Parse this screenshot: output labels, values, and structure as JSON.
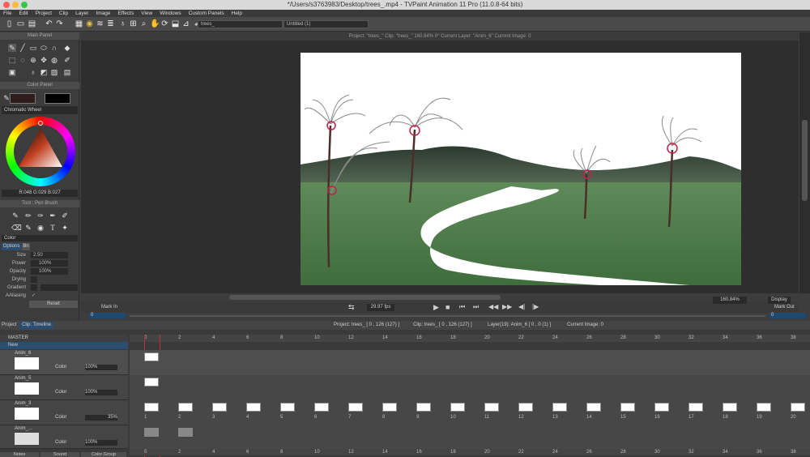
{
  "window": {
    "title": "*/Users/s3763983/Desktop/trees_.mp4 - TVPaint Animation 11 Pro (11.0.8-64 bits)"
  },
  "menu": [
    "File",
    "Edit",
    "Project",
    "Clip",
    "Layer",
    "Image",
    "Effects",
    "View",
    "Windows",
    "Custom Panels",
    "Help"
  ],
  "toolbar": {
    "brush_select": "trees_",
    "layer_select": "Untitled (1)"
  },
  "project_info": "Project: \"trees_\"  Clip: \"trees_\"  160.84%  0°  Current Layer: \"Anim_6\"  Current Image: 0",
  "panels": {
    "main": "Main Panel",
    "color": "Color Panel",
    "tool": "Tool : Pen Brush"
  },
  "color_panel": {
    "mode": "Chromatic Wheel",
    "readout": "R:048 G:029 B:027",
    "primary": "#301d1b",
    "secondary": "#000000"
  },
  "tool_panel": {
    "color_label": "Color",
    "tabs": [
      "Options",
      "Bn"
    ],
    "params": [
      {
        "label": "Size",
        "value": "2.50"
      },
      {
        "label": "Power",
        "value": "100%"
      },
      {
        "label": "Opacity",
        "value": "100%"
      },
      {
        "label": "Drying",
        "value": ""
      },
      {
        "label": "Gradient",
        "value": ""
      },
      {
        "label": "AAliasing",
        "value": "✓"
      }
    ],
    "reset": "Reset"
  },
  "playback": {
    "fps": "29.97 fps",
    "zoom": "160.84%",
    "display": "Display",
    "mark_in": "Mark In",
    "mark_out": "Mark Out",
    "mark_in_value": "0",
    "mark_out_value": "0"
  },
  "tabs": {
    "project": "Project",
    "clip_timeline": "Clip: Timeline"
  },
  "timeline": {
    "info": [
      "Project: trees_ [ 0 , 126  (127) ]",
      "Clip: trees_ [ 0 , 126  (127) ]",
      "Layer(19): Anim_6 [ 0 , 0  (1) ]",
      "Current Image: 0"
    ],
    "master": "MASTER",
    "new": "New",
    "frame_numbers": [
      "0",
      "2",
      "4",
      "6",
      "8",
      "10",
      "12",
      "14",
      "16",
      "18",
      "20",
      "22",
      "24",
      "26",
      "28",
      "30",
      "32",
      "34",
      "36",
      "38"
    ],
    "layers": [
      {
        "name": "Anim_6",
        "mode": "Color",
        "opacity": "100%"
      },
      {
        "name": "Anim_5",
        "mode": "Color",
        "opacity": "100%"
      },
      {
        "name": "Anim_3",
        "mode": "Color",
        "opacity": "35%"
      },
      {
        "name": "Anim_...",
        "mode": "Color",
        "opacity": "100%"
      }
    ],
    "cell_labels": [
      "1",
      "2",
      "3",
      "4",
      "5",
      "6",
      "7",
      "8",
      "9",
      "10",
      "11",
      "12",
      "13",
      "14",
      "15",
      "16",
      "17",
      "18",
      "19",
      "20"
    ]
  },
  "bottom_tabs": [
    "Notes",
    "Sound",
    "Color Group"
  ]
}
